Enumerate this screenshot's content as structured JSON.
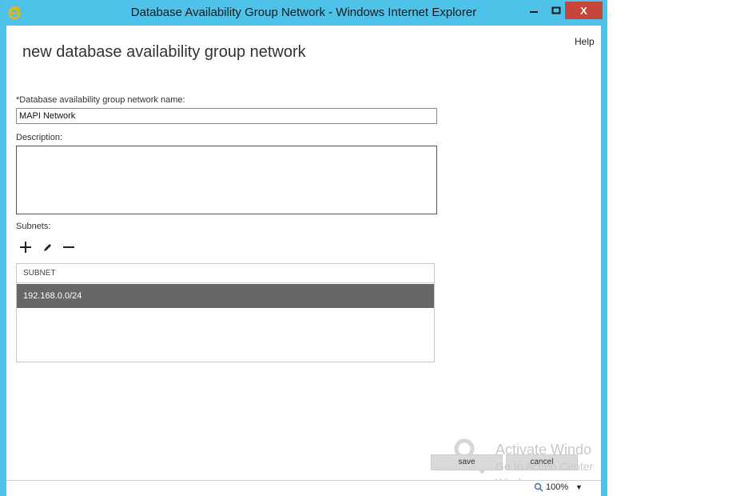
{
  "window": {
    "title": "Database Availability Group Network - Windows Internet Explorer",
    "close_glyph": "X"
  },
  "header": {
    "help": "Help",
    "page_title": "new database availability group network"
  },
  "form": {
    "name_label": "*Database availability group network name:",
    "name_value": "MAPI Network",
    "description_label": "Description:",
    "description_value": "",
    "subnets_label": "Subnets:"
  },
  "subnets": {
    "column_header": "SUBNET",
    "rows": [
      "192.168.0.0/24"
    ]
  },
  "footer": {
    "save": "save",
    "cancel": "cancel"
  },
  "watermark": {
    "line1": "Activate Windo",
    "line2": "Go to Action Center",
    "line3": "Windo"
  },
  "statusbar": {
    "zoom": "100%"
  },
  "colors": {
    "frame": "#4ec2e9",
    "close_button": "#c7463b",
    "selected_row": "#676767"
  }
}
